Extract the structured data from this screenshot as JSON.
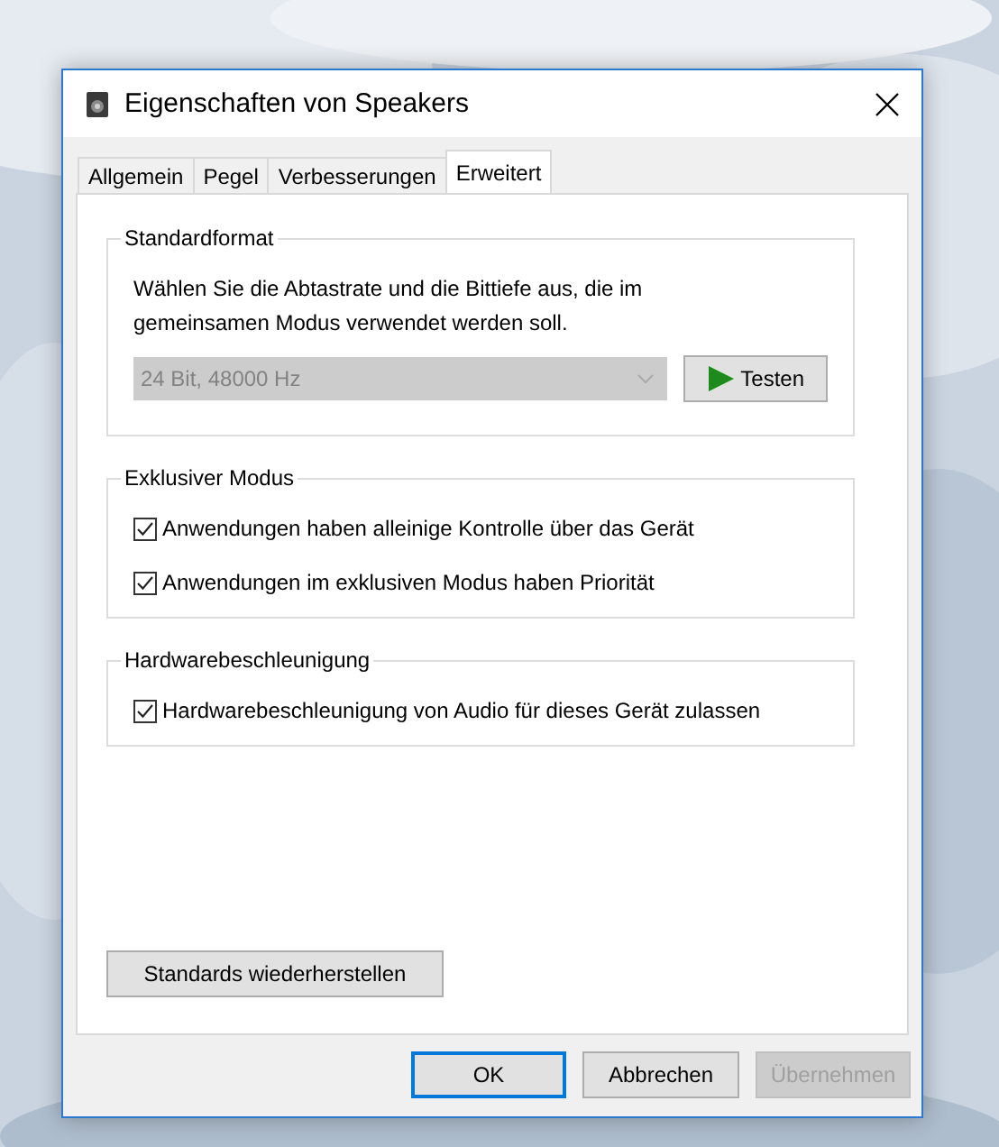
{
  "window": {
    "title": "Eigenschaften von Speakers"
  },
  "tabs": [
    {
      "label": "Allgemein",
      "selected": false
    },
    {
      "label": "Pegel",
      "selected": false
    },
    {
      "label": "Verbesserungen",
      "selected": false
    },
    {
      "label": "Erweitert",
      "selected": true
    }
  ],
  "groups": [
    {
      "kind": "format",
      "title": "Standardformat",
      "description": "Wählen Sie die Abtastrate und die Bittiefe aus, die im gemeinsamen Modus verwendet werden soll.",
      "dropdown": {
        "value": "24 Bit, 48000 Hz",
        "disabled": true
      },
      "test_button": "Testen"
    },
    {
      "kind": "checks",
      "title": "Exklusiver Modus",
      "options": [
        {
          "label": "Anwendungen haben alleinige Kontrolle über das Gerät",
          "checked": true
        },
        {
          "label": "Anwendungen im exklusiven Modus haben Priorität",
          "checked": true
        }
      ]
    },
    {
      "kind": "checks",
      "title": "Hardwarebeschleunigung",
      "options": [
        {
          "label": "Hardwarebeschleunigung von Audio für dieses Gerät zulassen",
          "checked": true
        }
      ]
    }
  ],
  "restore_button": "Standards wiederherstellen",
  "buttons": [
    {
      "label": "OK",
      "default": true,
      "disabled": false
    },
    {
      "label": "Abbrechen",
      "default": false,
      "disabled": false
    },
    {
      "label": "Übernehmen",
      "default": false,
      "disabled": true
    }
  ]
}
